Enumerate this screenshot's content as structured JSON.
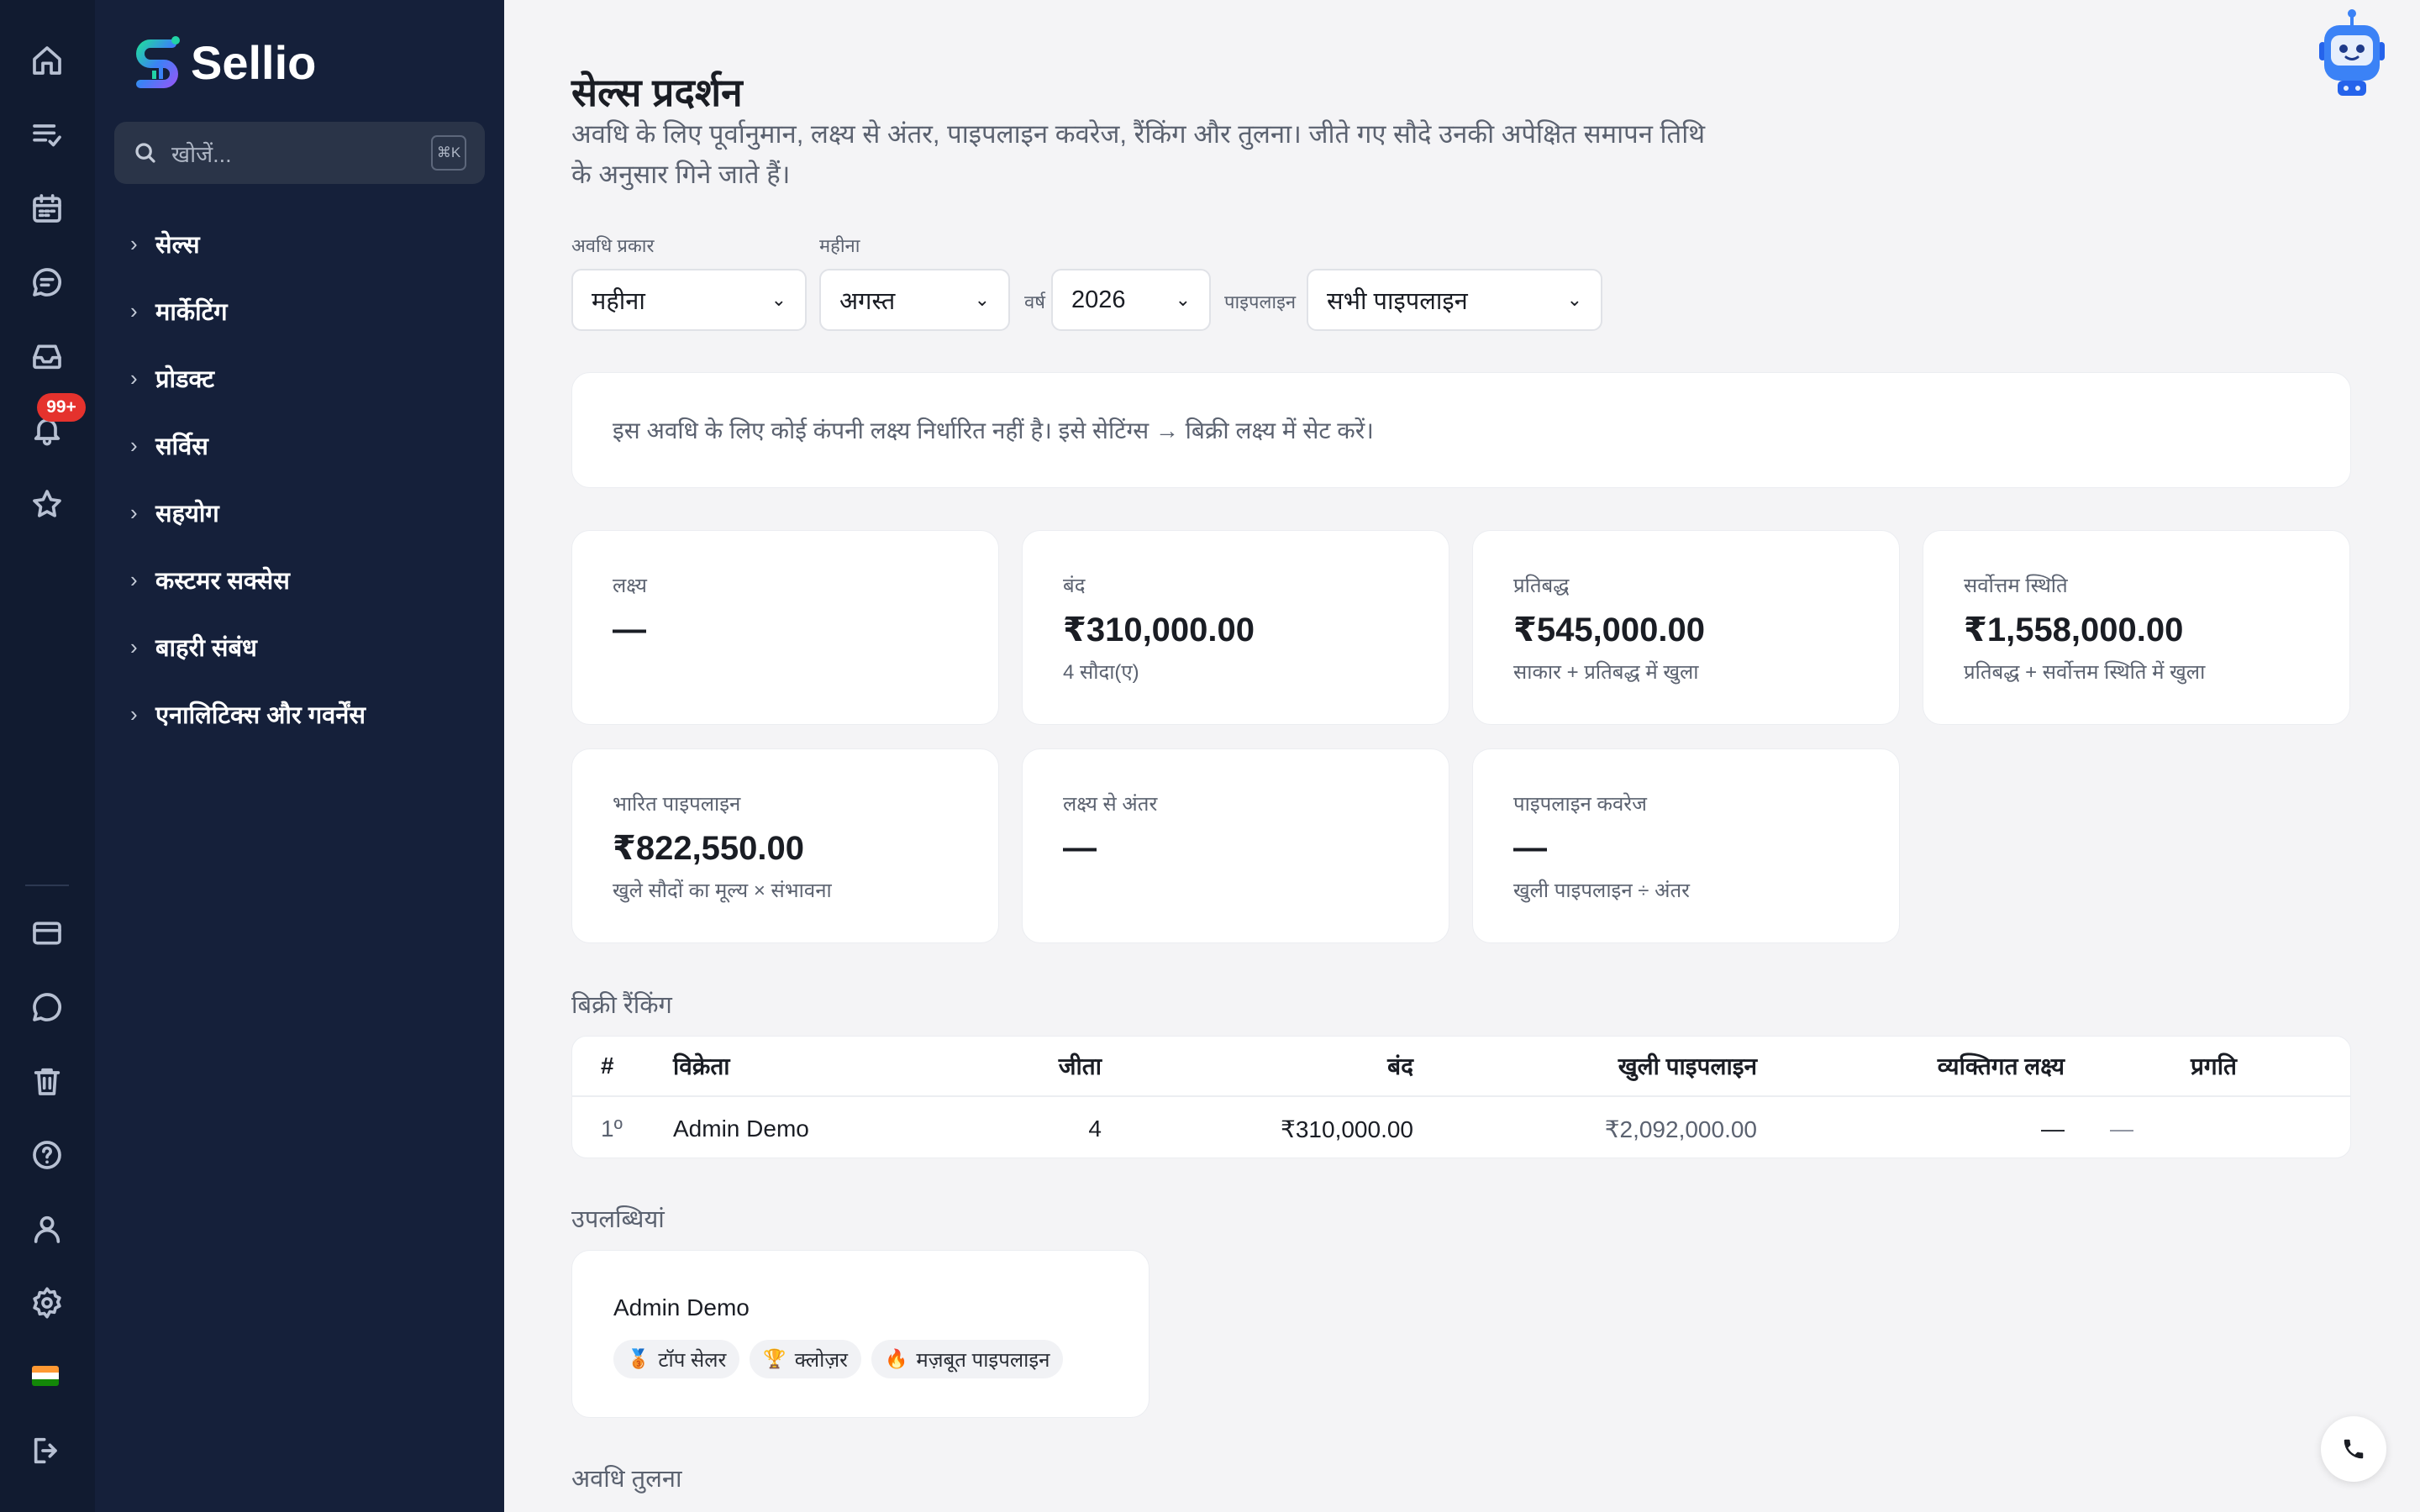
{
  "app": {
    "name": "Sellio"
  },
  "rail": {
    "icons": [
      "home-icon",
      "tasks-icon",
      "calendar-icon",
      "chat-icon",
      "inbox-icon",
      "bell-icon",
      "star-icon",
      "card-icon",
      "message-icon",
      "trash-icon",
      "help-icon",
      "user-icon",
      "settings-icon",
      "flag-icon",
      "logout-icon"
    ],
    "notification_badge": "99+"
  },
  "sidebar": {
    "search_placeholder": "खोजें...",
    "search_shortcut": "⌘K",
    "items": [
      {
        "label": "सेल्स"
      },
      {
        "label": "मार्केटिंग"
      },
      {
        "label": "प्रोडक्ट"
      },
      {
        "label": "सर्विस"
      },
      {
        "label": "सहयोग"
      },
      {
        "label": "कस्टमर सक्सेस"
      },
      {
        "label": "बाहरी संबंध"
      },
      {
        "label": "एनालिटिक्स और गवर्नेंस"
      }
    ]
  },
  "page": {
    "title": "सेल्स प्रदर्शन",
    "description": "अवधि के लिए पूर्वानुमान, लक्ष्य से अंतर, पाइपलाइन कवरेज, रैंकिंग और तुलना। जीते गए सौदे उनकी अपेक्षित समापन तिथि के अनुसार गिने जाते हैं।"
  },
  "filters": {
    "period_type_label": "अवधि प्रकार",
    "period_type_value": "महीना",
    "month_label": "महीना",
    "month_value": "अगस्त",
    "year_label": "वर्ष",
    "year_value": "2026",
    "pipeline_label": "पाइपलाइन",
    "pipeline_value": "सभी पाइपलाइन"
  },
  "banner": {
    "text": "इस अवधि के लिए कोई कंपनी लक्ष्य निर्धारित नहीं है। इसे सेटिंग्स → बिक्री लक्ष्य में सेट करें।"
  },
  "cards": [
    {
      "label": "लक्ष्य",
      "value": "—",
      "sub": ""
    },
    {
      "label": "बंद",
      "value": "₹310,000.00",
      "sub": "4 सौदा(ए)"
    },
    {
      "label": "प्रतिबद्ध",
      "value": "₹545,000.00",
      "sub": "साकार + प्रतिबद्ध में खुला"
    },
    {
      "label": "सर्वोत्तम स्थिति",
      "value": "₹1,558,000.00",
      "sub": "प्रतिबद्ध + सर्वोत्तम स्थिति में खुला"
    },
    {
      "label": "भारित पाइपलाइन",
      "value": "₹822,550.00",
      "sub": "खुले सौदों का मूल्य × संभावना"
    },
    {
      "label": "लक्ष्य से अंतर",
      "value": "—",
      "sub": ""
    },
    {
      "label": "पाइपलाइन कवरेज",
      "value": "—",
      "sub": "खुली पाइपलाइन ÷ अंतर"
    }
  ],
  "ranking": {
    "title": "बिक्री रैंकिंग",
    "headers": {
      "rank": "#",
      "seller": "विक्रेता",
      "won": "जीता",
      "closed": "बंद",
      "open_pipeline": "खुली पाइपलाइन",
      "personal_target": "व्यक्तिगत लक्ष्य",
      "progress": "प्रगति"
    },
    "rows": [
      {
        "rank": "1º",
        "seller": "Admin Demo",
        "won": "4",
        "closed": "₹310,000.00",
        "open_pipeline": "₹2,092,000.00",
        "personal_target": "—",
        "progress": "—"
      }
    ]
  },
  "achievements": {
    "title": "उपलब्धियां",
    "name": "Admin Demo",
    "badges": [
      {
        "emoji": "🥉",
        "label": "टॉप सेलर"
      },
      {
        "emoji": "🏆",
        "label": "क्लोज़र"
      },
      {
        "emoji": "🔥",
        "label": "मज़बूत पाइपलाइन"
      }
    ]
  },
  "comparison": {
    "title": "अवधि तुलना"
  },
  "colors": {
    "rail_bg": "#111b30",
    "sidebar_bg": "#15203a",
    "badge": "#e5322d",
    "page_bg": "#f4f4f6"
  }
}
